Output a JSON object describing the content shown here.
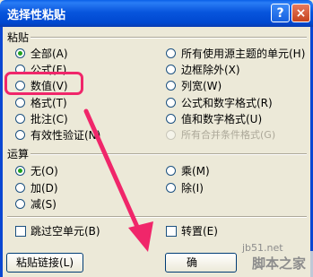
{
  "window": {
    "title": "选择性粘贴",
    "help_label": "?",
    "close_label": "×"
  },
  "paste": {
    "group_label": "粘贴",
    "left_options": [
      {
        "label": "全部(A)",
        "selected": true
      },
      {
        "label": "公式(F)",
        "selected": false
      },
      {
        "label": "数值(V)",
        "selected": false
      },
      {
        "label": "格式(T)",
        "selected": false
      },
      {
        "label": "批注(C)",
        "selected": false
      },
      {
        "label": "有效性验证(N)",
        "selected": false
      }
    ],
    "right_options": [
      {
        "label": "所有使用源主题的单元(H)",
        "selected": false,
        "disabled": false
      },
      {
        "label": "边框除外(X)",
        "selected": false,
        "disabled": false
      },
      {
        "label": "列宽(W)",
        "selected": false,
        "disabled": false
      },
      {
        "label": "公式和数字格式(R)",
        "selected": false,
        "disabled": false
      },
      {
        "label": "值和数字格式(U)",
        "selected": false,
        "disabled": false
      },
      {
        "label": "所有合并条件格式(G)",
        "selected": false,
        "disabled": true
      }
    ]
  },
  "operation": {
    "group_label": "运算",
    "left_options": [
      {
        "label": "无(O)",
        "selected": true
      },
      {
        "label": "加(D)",
        "selected": false
      },
      {
        "label": "减(S)",
        "selected": false
      }
    ],
    "right_options": [
      {
        "label": "乘(M)",
        "selected": false
      },
      {
        "label": "除(I)",
        "selected": false
      }
    ]
  },
  "checks": {
    "skip_blanks": {
      "label": "跳过空单元(B)",
      "checked": false
    },
    "transpose": {
      "label": "转置(E)",
      "checked": false
    }
  },
  "buttons": {
    "paste_link": "粘贴链接(L)",
    "ok": "确"
  },
  "watermark": {
    "url": "jb51.net",
    "name": "脚本之家"
  },
  "colors": {
    "highlight": "#f0266a",
    "arrow": "#f0266a",
    "radio_dot": "#21a121",
    "title_bar": "#0855dd"
  }
}
